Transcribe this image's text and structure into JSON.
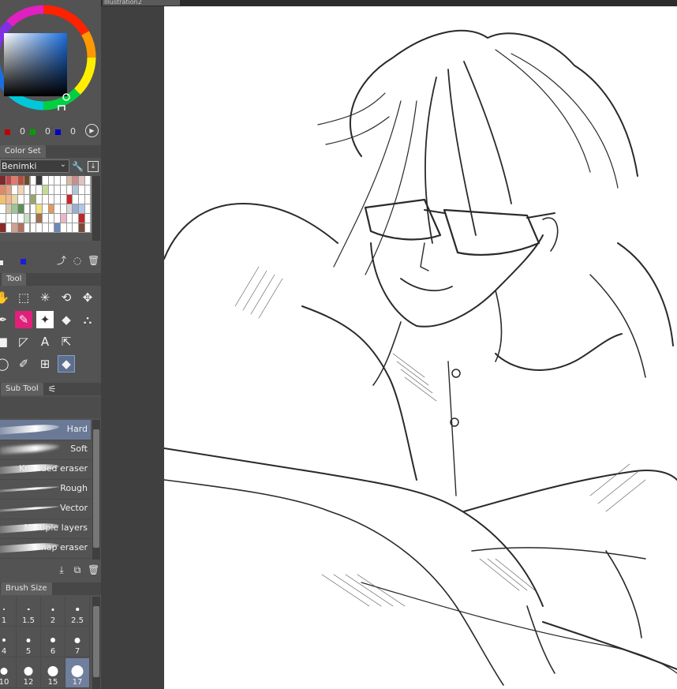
{
  "document": {
    "tab_title": "Illustration2"
  },
  "color_wheel": {
    "r": "0",
    "g": "0",
    "b": "0"
  },
  "color_set": {
    "tab_label": "Color Set",
    "set_name": "Benimki",
    "swatches": [
      "#7a2c2c",
      "#c04848",
      "#e07b6b",
      "#b34f3f",
      "#6b4b2a",
      "#ffffff",
      "#3b3b3b",
      "#ffffff",
      "#ffffff",
      "#ffffff",
      "#ffffff",
      "#d9b8a6",
      "#c78f8f",
      "#e2c1c1",
      "#ffffff",
      "#d98b6b",
      "#e8a07b",
      "#ffffff",
      "#f4d2b8",
      "#ffffff",
      "#ffffff",
      "#ffffff",
      "#c7d89b",
      "#ffffff",
      "#ffffff",
      "#ffffff",
      "#ffffff",
      "#b3c4d9",
      "#ffffff",
      "#ffffff",
      "#f0c070",
      "#f6b58a",
      "#e9d7a8",
      "#ffffff",
      "#ffffff",
      "#9aa56b",
      "#ffffff",
      "#ffffff",
      "#ffffff",
      "#ffffff",
      "#ffffff",
      "#c82828",
      "#ffffff",
      "#ffffff",
      "#ffffff",
      "#ffffff",
      "#d7c9a8",
      "#9bc49a",
      "#5e8d5b",
      "#ffffff",
      "#ffffff",
      "#f0e07b",
      "#ffffff",
      "#e59a5a",
      "#ffffff",
      "#ffffff",
      "#d8d8d8",
      "#9aaed0",
      "#b0c8e8",
      "#ffffff",
      "#ffffff",
      "#ffffff",
      "#ffffff",
      "#ffffff",
      "#c8e0c0",
      "#ffffff",
      "#a07050",
      "#ffffff",
      "#ffffff",
      "#ffffff",
      "#e9b7c7",
      "#ffffff",
      "#ffffff",
      "#c02828",
      "#ffffff",
      "#8a2a2a",
      "#ffffff",
      "#d0a090",
      "#b07060",
      "#ffffff",
      "#ffffff",
      "#ffffff",
      "#ffffff",
      "#ffffff",
      "#6a88b8",
      "#ffffff",
      "#ffffff",
      "#ffffff",
      "#7a4a3a",
      "#ffffff"
    ]
  },
  "tool_palette": {
    "tab_label": "Tool",
    "tools": [
      {
        "name": "hand-tool-icon",
        "glyph": "✋"
      },
      {
        "name": "operation-tool-icon",
        "glyph": "⬚"
      },
      {
        "name": "auto-select-tool-icon",
        "glyph": "✳"
      },
      {
        "name": "lasso-tool-icon",
        "glyph": "⟲"
      },
      {
        "name": "move-tool-icon",
        "glyph": "✥"
      },
      {
        "name": "pen-tool-icon",
        "glyph": "✒"
      },
      {
        "name": "brush-tool-icon",
        "glyph": "✎"
      },
      {
        "name": "decoration-tool-icon",
        "glyph": "✦"
      },
      {
        "name": "fill-tool-icon",
        "glyph": "◆"
      },
      {
        "name": "airbrush-tool-icon",
        "glyph": "⛬"
      },
      {
        "name": "figure-tool-icon",
        "glyph": "■"
      },
      {
        "name": "frame-border-tool-icon",
        "glyph": "◸"
      },
      {
        "name": "text-tool-icon",
        "glyph": "A"
      },
      {
        "name": "balloon-tool-icon",
        "glyph": "⇱"
      },
      {
        "name": "empty-slot",
        "glyph": ""
      },
      {
        "name": "selection-tool-icon",
        "glyph": "◯"
      },
      {
        "name": "eyedropper-tool-icon",
        "glyph": "✐"
      },
      {
        "name": "ruler-tool-icon",
        "glyph": "⊞"
      },
      {
        "name": "eraser-tool-icon",
        "glyph": "◆"
      },
      {
        "name": "empty-slot-2",
        "glyph": ""
      }
    ]
  },
  "sub_tool": {
    "tab_label": "Sub Tool",
    "brushes": [
      {
        "label": "Hard"
      },
      {
        "label": "Soft"
      },
      {
        "label": "Kneaded eraser"
      },
      {
        "label": "Rough"
      },
      {
        "label": "Vector"
      },
      {
        "label": "Multiple layers"
      },
      {
        "label": "Snap eraser"
      }
    ]
  },
  "brush_size": {
    "tab_label": "Brush Size",
    "sizes": [
      "1",
      "1.5",
      "2",
      "2.5",
      "4",
      "5",
      "6",
      "7",
      "10",
      "12",
      "15",
      "17"
    ]
  }
}
